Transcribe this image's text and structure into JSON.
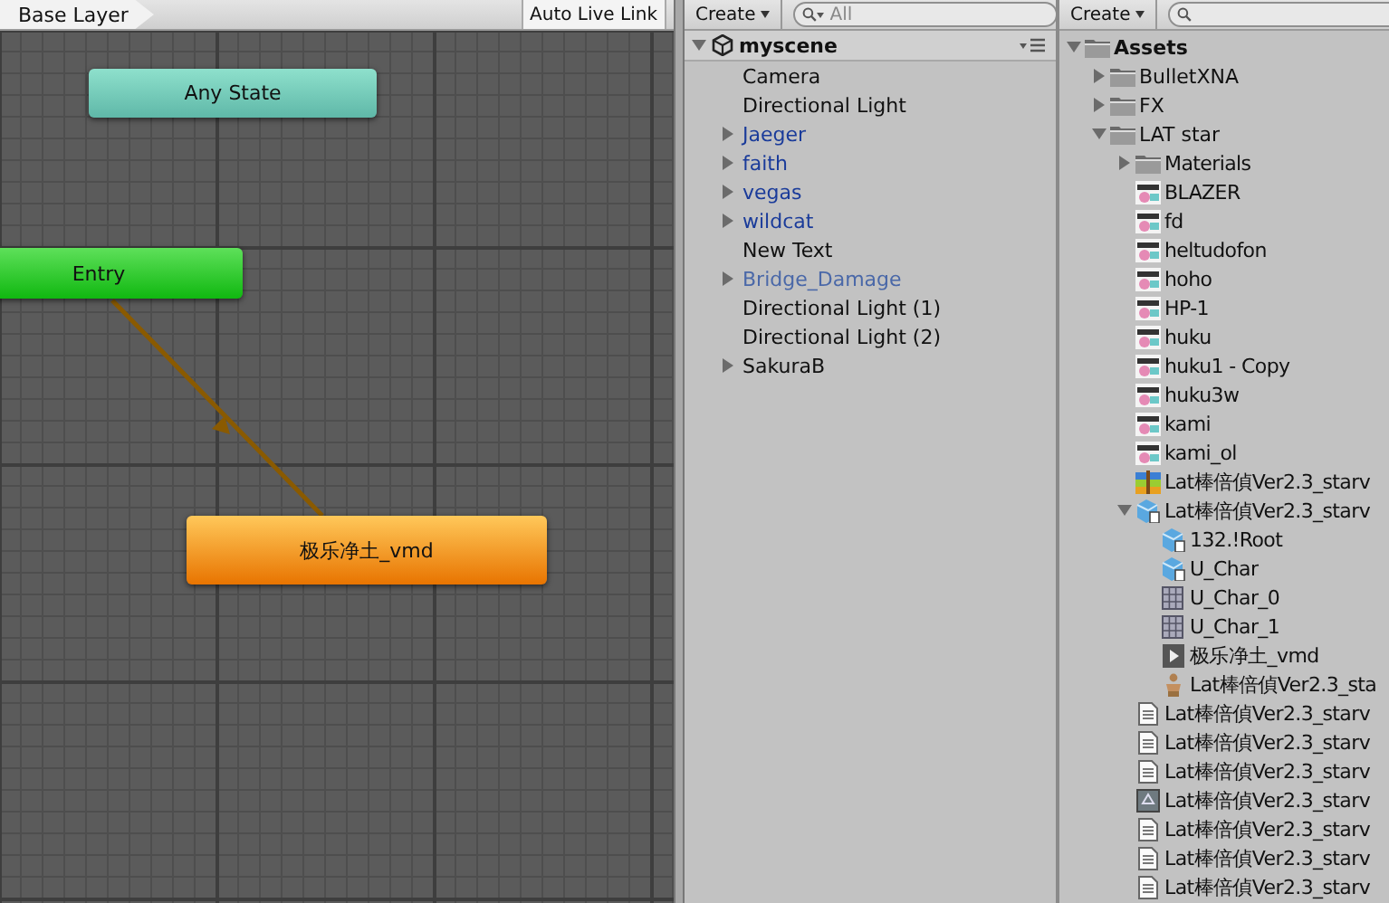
{
  "animator": {
    "breadcrumb": "Base Layer",
    "live_link_button": "Auto Live Link",
    "states": [
      {
        "label": "Any State",
        "kind": "any"
      },
      {
        "label": "Entry",
        "kind": "entry"
      },
      {
        "label": "极乐净土_vmd",
        "kind": "default"
      }
    ]
  },
  "hierarchy": {
    "create_button": "Create",
    "search": {
      "placeholder": "All"
    },
    "scene": {
      "label": "myscene",
      "expanded": true
    },
    "items": [
      {
        "label": "Camera",
        "kind": "object"
      },
      {
        "label": "Directional Light",
        "kind": "object"
      },
      {
        "label": "Jaeger",
        "kind": "prefab",
        "expanded": false
      },
      {
        "label": "faith",
        "kind": "prefab",
        "expanded": false
      },
      {
        "label": "vegas",
        "kind": "prefab",
        "expanded": false
      },
      {
        "label": "wildcat",
        "kind": "prefab",
        "expanded": false
      },
      {
        "label": "New Text",
        "kind": "object"
      },
      {
        "label": "Bridge_Damage",
        "kind": "missing",
        "expanded": false
      },
      {
        "label": "Directional Light (1)",
        "kind": "object"
      },
      {
        "label": "Directional Light (2)",
        "kind": "object"
      },
      {
        "label": "SakuraB",
        "kind": "object",
        "expanded": false
      }
    ]
  },
  "project": {
    "create_button": "Create",
    "tree": [
      {
        "label": "Assets",
        "kind": "folder",
        "expanded": true,
        "children": [
          {
            "label": "BulletXNA",
            "kind": "folder",
            "expanded": false
          },
          {
            "label": "FX",
            "kind": "folder",
            "expanded": false
          },
          {
            "label": "LAT star",
            "kind": "folder",
            "expanded": true,
            "children": [
              {
                "label": "Materials",
                "kind": "folder",
                "expanded": false
              },
              {
                "label": "BLAZER",
                "kind": "texture"
              },
              {
                "label": "fd",
                "kind": "texture"
              },
              {
                "label": "heltudofon",
                "kind": "texture"
              },
              {
                "label": "hoho",
                "kind": "texture"
              },
              {
                "label": "HP-1",
                "kind": "texture"
              },
              {
                "label": "huku",
                "kind": "texture"
              },
              {
                "label": "huku1 - Copy",
                "kind": "texture"
              },
              {
                "label": "huku3w",
                "kind": "texture"
              },
              {
                "label": "kami",
                "kind": "texture"
              },
              {
                "label": "kami_ol",
                "kind": "texture"
              },
              {
                "label": "Lat棒倍偵Ver2.3_starv",
                "kind": "archive"
              },
              {
                "label": "Lat棒倍偵Ver2.3_starv",
                "kind": "prefab",
                "expanded": true,
                "children": [
                  {
                    "label": "132.!Root",
                    "kind": "prefab"
                  },
                  {
                    "label": "U_Char",
                    "kind": "prefab"
                  },
                  {
                    "label": "U_Char_0",
                    "kind": "mesh"
                  },
                  {
                    "label": "U_Char_1",
                    "kind": "mesh"
                  },
                  {
                    "label": "极乐净土_vmd",
                    "kind": "clip"
                  },
                  {
                    "label": "Lat棒倍偵Ver2.3_sta",
                    "kind": "avatar"
                  }
                ]
              },
              {
                "label": "Lat棒倍偵Ver2.3_starv",
                "kind": "text"
              },
              {
                "label": "Lat棒倍偵Ver2.3_starv",
                "kind": "text"
              },
              {
                "label": "Lat棒倍偵Ver2.3_starv",
                "kind": "text"
              },
              {
                "label": "Lat棒倍偵Ver2.3_starv",
                "kind": "shader"
              },
              {
                "label": "Lat棒倍偵Ver2.3_starv",
                "kind": "text"
              },
              {
                "label": "Lat棒倍偵Ver2.3_starv",
                "kind": "text"
              },
              {
                "label": "Lat棒倍偵Ver2.3_starv",
                "kind": "text"
              }
            ]
          }
        ]
      }
    ]
  }
}
